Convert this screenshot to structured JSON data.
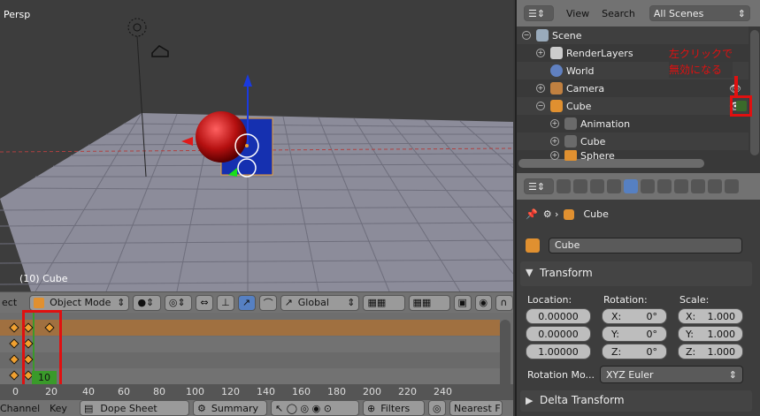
{
  "viewport": {
    "persp_label": "Persp",
    "object_label": "(10) Cube"
  },
  "vp_header": {
    "menu_fragment": "ect",
    "mode": "Object Mode",
    "orientation": "Global"
  },
  "dopesheet": {
    "current_frame": "10",
    "ruler_ticks": [
      "0",
      "20",
      "40",
      "60",
      "80",
      "100",
      "120",
      "140",
      "160",
      "180",
      "200",
      "220",
      "240"
    ],
    "header": {
      "channel": "Channel",
      "key": "Key",
      "mode": "Dope Sheet",
      "summary": "Summary",
      "filters": "Filters",
      "nearest": "Nearest F"
    }
  },
  "outliner": {
    "view": "View",
    "search": "Search",
    "scene_select": "All Scenes",
    "annotation": [
      "左クリックで",
      "無効になる"
    ],
    "items": [
      {
        "label": "Scene"
      },
      {
        "label": "RenderLayers"
      },
      {
        "label": "World"
      },
      {
        "label": "Camera"
      },
      {
        "label": "Cube"
      },
      {
        "label": "Animation"
      },
      {
        "label": "Cube"
      },
      {
        "label": "Sphere"
      }
    ]
  },
  "properties": {
    "breadcrumb": "Cube",
    "object_name": "Cube",
    "transform_title": "Transform",
    "location_label": "Location:",
    "rotation_label": "Rotation:",
    "scale_label": "Scale:",
    "location": [
      "0.00000",
      "0.00000",
      "1.00000"
    ],
    "rotation": [
      {
        "axis": "X:",
        "value": "0°"
      },
      {
        "axis": "Y:",
        "value": "0°"
      },
      {
        "axis": "Z:",
        "value": "0°"
      }
    ],
    "scale": [
      {
        "axis": "X:",
        "value": "1.000"
      },
      {
        "axis": "Y:",
        "value": "1.000"
      },
      {
        "axis": "Z:",
        "value": "1.000"
      }
    ],
    "rotation_mode_label": "Rotation Mo...",
    "rotation_mode": "XYZ Euler",
    "delta_title": "Delta Transform"
  },
  "colors": {
    "highlight_red": "#e01010",
    "keyframe": "#f0a030",
    "summary_row": "#a07040",
    "frame_indicator": "#3a9a2a"
  }
}
